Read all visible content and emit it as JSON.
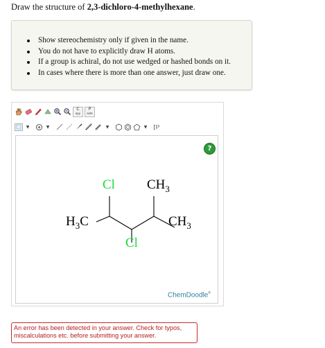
{
  "question": {
    "prefix": "Draw the structure of ",
    "compound": "2,3-dichloro-4-methylhexane",
    "suffix": "."
  },
  "instructions": [
    "Show stereochemistry only if given in the name.",
    "You do not have to explicitly draw H atoms.",
    "If a group is achiral, do not use wedged or hashed bonds on it.",
    "In cases where there is more than one answer, just draw one."
  ],
  "toolbar": {
    "row1": [
      "hand-icon",
      "erase-icon",
      "lasso-icon",
      "color-icon",
      "zoom-in-icon",
      "zoom-out-icon"
    ],
    "copy_label": "C",
    "copy_sub": "opy",
    "paste_label": "P",
    "paste_sub": "aste",
    "row2": [
      "select-icon",
      "charge-icon",
      "bond-single-icon",
      "bond-wedge-icon",
      "bond-hash-icon",
      "bond-double-icon",
      "ring-cyclohexane-icon",
      "ring-benzene-icon",
      "ring-pentagon-icon",
      "text-icon"
    ],
    "text_label": "[I³"
  },
  "molecule": {
    "cl_top": "Cl",
    "cl_bottom": "Cl",
    "ch3_top": "CH",
    "ch3_top_sub": "3",
    "ch3_right": "CH",
    "ch3_right_sub": "3",
    "h3c_h": "H",
    "h3c_sub": "3",
    "h3c_c": "C"
  },
  "canvas": {
    "help_label": "?",
    "brand": "ChemDoodle",
    "brand_mark": "®"
  },
  "colors": {
    "chlorine": "#1fd63a",
    "bond": "#000000",
    "brand": "#2f7f9c",
    "error": "#c62828"
  },
  "error": {
    "line1": "An error has been detected in your answer. Check for typos,",
    "line2": "miscalculations etc. before submitting your answer."
  }
}
